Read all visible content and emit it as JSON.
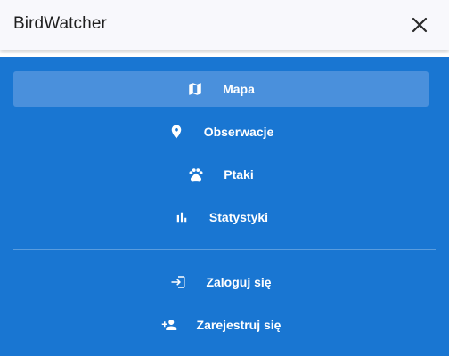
{
  "header": {
    "title": "BirdWatcher"
  },
  "menu": {
    "items": [
      {
        "label": "Mapa",
        "icon": "map-icon",
        "active": true
      },
      {
        "label": "Obserwacje",
        "icon": "location-pin-icon",
        "active": false
      },
      {
        "label": "Ptaki",
        "icon": "paw-icon",
        "active": false
      },
      {
        "label": "Statystyki",
        "icon": "bar-chart-icon",
        "active": false
      }
    ],
    "account_items": [
      {
        "label": "Zaloguj się",
        "icon": "login-icon"
      },
      {
        "label": "Zarejestruj się",
        "icon": "person-add-icon"
      }
    ]
  },
  "colors": {
    "header_bg": "#f8f8fc",
    "menu_bg": "#1976d2",
    "active_item_bg": "#4a90dc",
    "text_light": "#ffffff"
  }
}
